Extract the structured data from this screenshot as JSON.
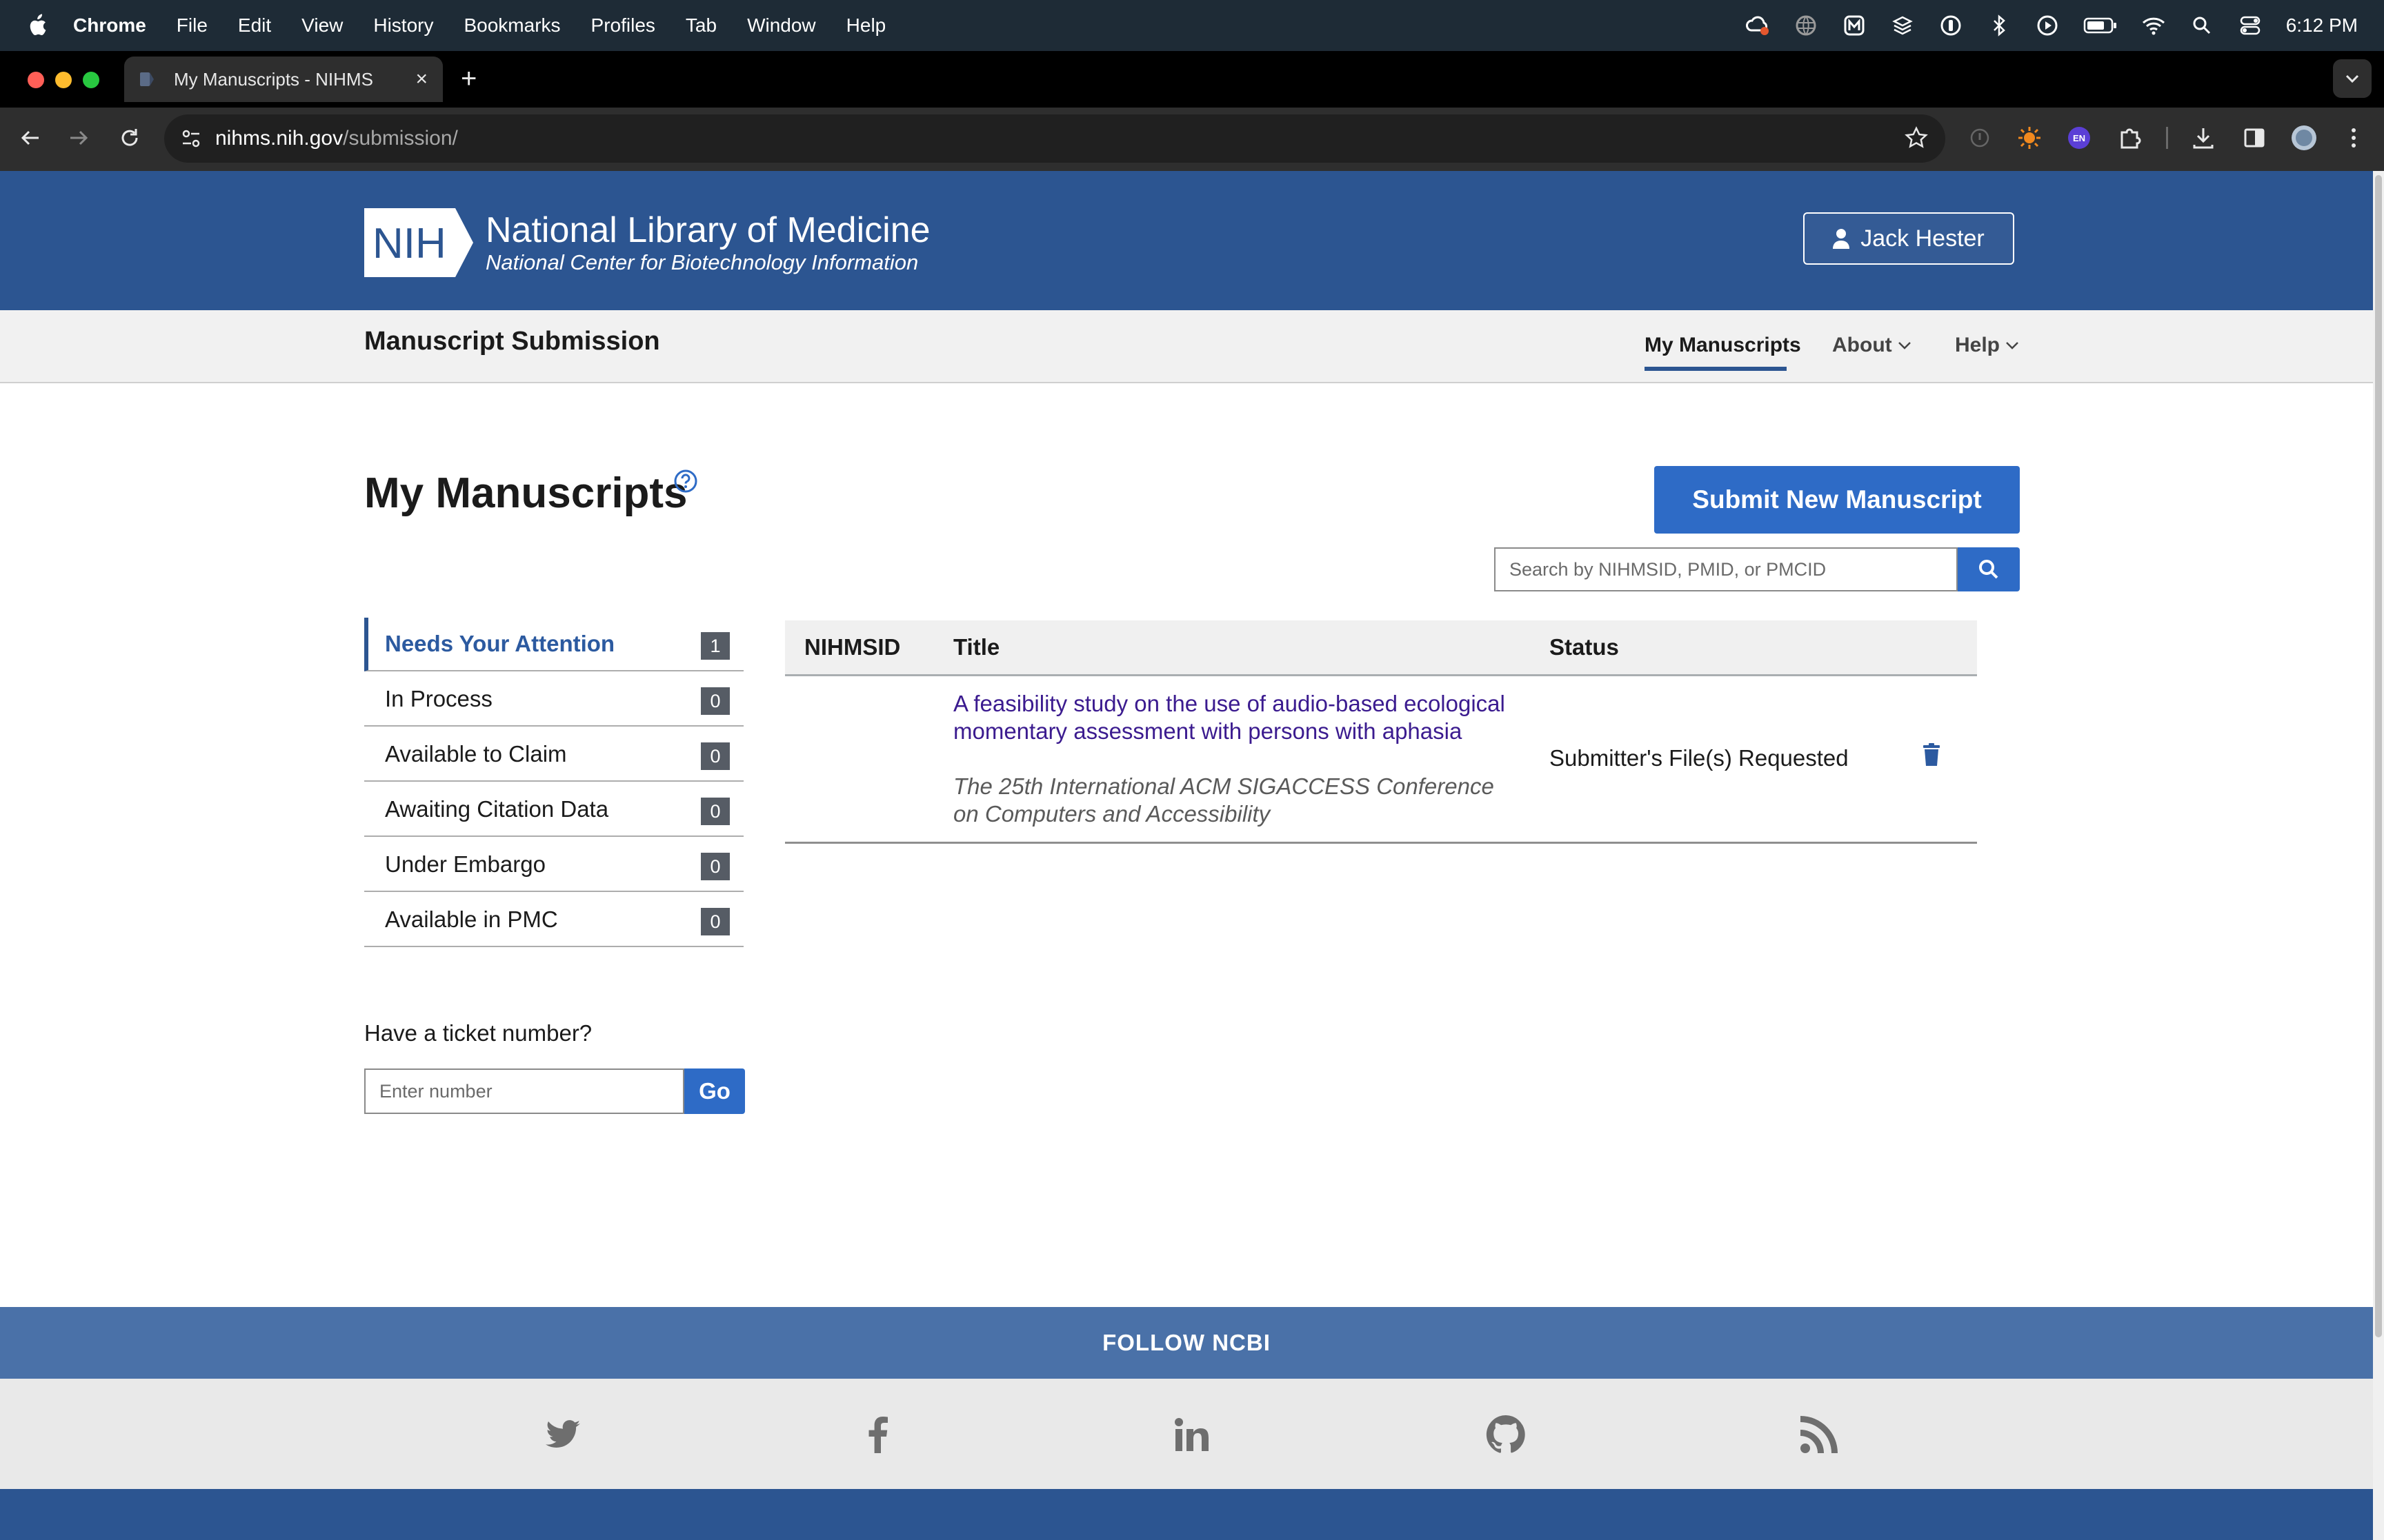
{
  "os_menubar": {
    "app_name": "Chrome",
    "items": [
      "File",
      "Edit",
      "View",
      "History",
      "Bookmarks",
      "Profiles",
      "Tab",
      "Window",
      "Help"
    ],
    "clock": "6:12 PM"
  },
  "browser": {
    "tab_title": "My Manuscripts - NIHMS",
    "new_tab_symbol": "+",
    "url_host": "nihms.nih.gov",
    "url_path": "/submission/",
    "extension_badge": "EN"
  },
  "header": {
    "logo_text": "NIH",
    "title": "National Library of Medicine",
    "subtitle": "National Center for Biotechnology Information",
    "user_name": "Jack Hester"
  },
  "subnav": {
    "site_name": "Manuscript Submission",
    "links": [
      {
        "label": "My Manuscripts",
        "active": true
      },
      {
        "label": "About",
        "active": false
      },
      {
        "label": "Help",
        "active": false
      }
    ]
  },
  "main": {
    "heading": "My Manuscripts",
    "submit_label": "Submit New Manuscript",
    "search_placeholder": "Search by NIHMSID, PMID, or PMCID"
  },
  "sidebar": {
    "items": [
      {
        "label": "Needs Your Attention",
        "count": "1",
        "active": true
      },
      {
        "label": "In Process",
        "count": "0",
        "active": false
      },
      {
        "label": "Available to Claim",
        "count": "0",
        "active": false
      },
      {
        "label": "Awaiting Citation Data",
        "count": "0",
        "active": false
      },
      {
        "label": "Under Embargo",
        "count": "0",
        "active": false
      },
      {
        "label": "Available in PMC",
        "count": "0",
        "active": false
      }
    ],
    "ticket_label": "Have a ticket number?",
    "ticket_placeholder": "Enter number",
    "ticket_button": "Go"
  },
  "table": {
    "columns": [
      "NIHMSID",
      "Title",
      "Status"
    ],
    "rows": [
      {
        "nihmsid": "",
        "title": "A feasibility study on the use of audio-based ecological momentary assessment with persons with aphasia",
        "conference": "The 25th International ACM SIGACCESS Conference on Computers and Accessibility",
        "status": "Submitter's File(s) Requested"
      }
    ]
  },
  "footer": {
    "follow_label": "FOLLOW NCBI",
    "social_icons": [
      "twitter-icon",
      "facebook-icon",
      "linkedin-icon",
      "github-icon",
      "rss-icon"
    ]
  },
  "colors": {
    "header_blue": "#2c5591",
    "button_blue": "#2e6bc6",
    "link_purple": "#3b1b8f",
    "follow_band": "#4a71a8"
  }
}
